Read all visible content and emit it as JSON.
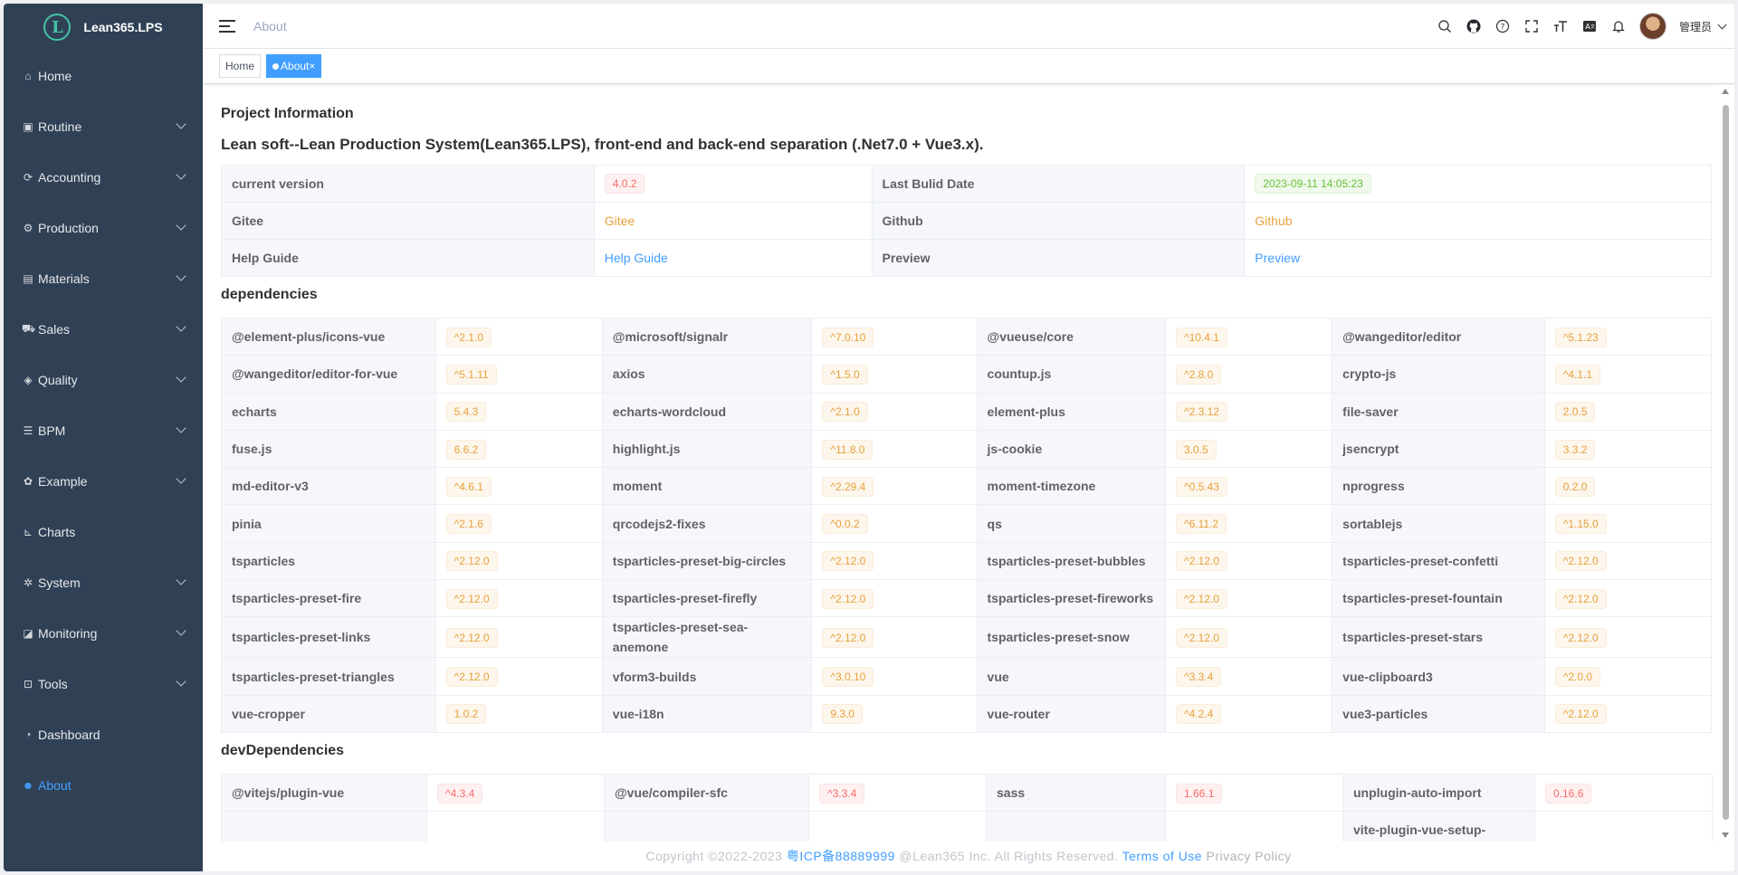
{
  "app": {
    "name": "Lean365.LPS",
    "logo_letter": "L"
  },
  "sidebar": {
    "items": [
      {
        "label": "Home",
        "icon": "home-icon",
        "glyph": "⌂",
        "chevron": false,
        "active": false
      },
      {
        "label": "Routine",
        "icon": "briefcase-icon",
        "glyph": "▣",
        "chevron": true,
        "active": false
      },
      {
        "label": "Accounting",
        "icon": "accounting-icon",
        "glyph": "⟳",
        "chevron": true,
        "active": false
      },
      {
        "label": "Production",
        "icon": "production-icon",
        "glyph": "⚙",
        "chevron": true,
        "active": false
      },
      {
        "label": "Materials",
        "icon": "materials-icon",
        "glyph": "▤",
        "chevron": true,
        "active": false
      },
      {
        "label": "Sales",
        "icon": "truck-icon",
        "glyph": "⛟",
        "chevron": true,
        "active": false
      },
      {
        "label": "Quality",
        "icon": "quality-icon",
        "glyph": "◈",
        "chevron": true,
        "active": false
      },
      {
        "label": "BPM",
        "icon": "bpm-icon",
        "glyph": "☰",
        "chevron": true,
        "active": false
      },
      {
        "label": "Example",
        "icon": "example-icon",
        "glyph": "✿",
        "chevron": true,
        "active": false
      },
      {
        "label": "Charts",
        "icon": "chart-icon",
        "glyph": "⊾",
        "chevron": false,
        "active": false
      },
      {
        "label": "System",
        "icon": "system-icon",
        "glyph": "✲",
        "chevron": true,
        "active": false
      },
      {
        "label": "Monitoring",
        "icon": "monitor-icon",
        "glyph": "◪",
        "chevron": true,
        "active": false
      },
      {
        "label": "Tools",
        "icon": "tools-icon",
        "glyph": "⊡",
        "chevron": true,
        "active": false
      },
      {
        "label": "Dashboard",
        "icon": "dashboard-icon",
        "glyph": "◔",
        "chevron": false,
        "active": false
      },
      {
        "label": "About",
        "icon": "users-icon",
        "glyph": "☻",
        "chevron": false,
        "active": true
      }
    ]
  },
  "header": {
    "breadcrumb": "About",
    "username": "管理员"
  },
  "tags": {
    "home": "Home",
    "about": "About",
    "close": "×"
  },
  "project": {
    "section_title": "Project Information",
    "tagline": "Lean soft--Lean Production System(Lean365.LPS), front-end and back-end separation (.Net7.0 + Vue3.x).",
    "rows": [
      {
        "label1": "current version",
        "value1": "4.0.2",
        "label2": "Last Bulid Date",
        "value2": "2023-09-11 14:05:23"
      },
      {
        "label1": "Gitee",
        "value1": "Gitee",
        "label2": "Github",
        "value2": "Github"
      },
      {
        "label1": "Help Guide",
        "value1": "Help Guide",
        "label2": "Preview",
        "value2": "Preview"
      }
    ]
  },
  "dependencies": {
    "title": "dependencies",
    "items": [
      [
        "@element-plus/icons-vue",
        "^2.1.0"
      ],
      [
        "@microsoft/signalr",
        "^7.0.10"
      ],
      [
        "@vueuse/core",
        "^10.4.1"
      ],
      [
        "@wangeditor/editor",
        "^5.1.23"
      ],
      [
        "@wangeditor/editor-for-vue",
        "^5.1.11"
      ],
      [
        "axios",
        "^1.5.0"
      ],
      [
        "countup.js",
        "^2.8.0"
      ],
      [
        "crypto-js",
        "^4.1.1"
      ],
      [
        "echarts",
        "5.4.3"
      ],
      [
        "echarts-wordcloud",
        "^2.1.0"
      ],
      [
        "element-plus",
        "^2.3.12"
      ],
      [
        "file-saver",
        "2.0.5"
      ],
      [
        "fuse.js",
        "6.6.2"
      ],
      [
        "highlight.js",
        "^11.8.0"
      ],
      [
        "js-cookie",
        "3.0.5"
      ],
      [
        "jsencrypt",
        "3.3.2"
      ],
      [
        "md-editor-v3",
        "^4.6.1"
      ],
      [
        "moment",
        "^2.29.4"
      ],
      [
        "moment-timezone",
        "^0.5.43"
      ],
      [
        "nprogress",
        "0.2.0"
      ],
      [
        "pinia",
        "^2.1.6"
      ],
      [
        "qrcodejs2-fixes",
        "^0.0.2"
      ],
      [
        "qs",
        "^6.11.2"
      ],
      [
        "sortablejs",
        "^1.15.0"
      ],
      [
        "tsparticles",
        "^2.12.0"
      ],
      [
        "tsparticles-preset-big-circles",
        "^2.12.0"
      ],
      [
        "tsparticles-preset-bubbles",
        "^2.12.0"
      ],
      [
        "tsparticles-preset-confetti",
        "^2.12.0"
      ],
      [
        "tsparticles-preset-fire",
        "^2.12.0"
      ],
      [
        "tsparticles-preset-firefly",
        "^2.12.0"
      ],
      [
        "tsparticles-preset-fireworks",
        "^2.12.0"
      ],
      [
        "tsparticles-preset-fountain",
        "^2.12.0"
      ],
      [
        "tsparticles-preset-links",
        "^2.12.0"
      ],
      [
        "tsparticles-preset-sea-anemone",
        "^2.12.0"
      ],
      [
        "tsparticles-preset-snow",
        "^2.12.0"
      ],
      [
        "tsparticles-preset-stars",
        "^2.12.0"
      ],
      [
        "tsparticles-preset-triangles",
        "^2.12.0"
      ],
      [
        "vform3-builds",
        "^3.0.10"
      ],
      [
        "vue",
        "^3.3.4"
      ],
      [
        "vue-clipboard3",
        "^2.0.0"
      ],
      [
        "vue-cropper",
        "1.0.2"
      ],
      [
        "vue-i18n",
        "9.3.0"
      ],
      [
        "vue-router",
        "^4.2.4"
      ],
      [
        "vue3-particles",
        "^2.12.0"
      ]
    ]
  },
  "devDependencies": {
    "title": "devDependencies",
    "items": [
      [
        "@vitejs/plugin-vue",
        "^4.3.4"
      ],
      [
        "@vue/compiler-sfc",
        "^3.3.4"
      ],
      [
        "sass",
        "1.66.1"
      ],
      [
        "unplugin-auto-import",
        "0.16.6"
      ],
      [
        "",
        ""
      ],
      [
        "",
        ""
      ],
      [
        "",
        ""
      ],
      [
        "vite-plugin-vue-setup-",
        ""
      ]
    ]
  },
  "footer": {
    "copyright": "Copyright ©2022-2023",
    "icp": "粤ICP备88889999",
    "company": "@Lean365 Inc. All Rights Reserved.",
    "terms": "Terms of Use",
    "privacy": "Privacy Policy"
  },
  "colors": {
    "sidebar_bg": "#304156",
    "primary": "#409eff",
    "warning": "#e6a23c",
    "danger": "#f56c6c",
    "success": "#67c23a"
  }
}
